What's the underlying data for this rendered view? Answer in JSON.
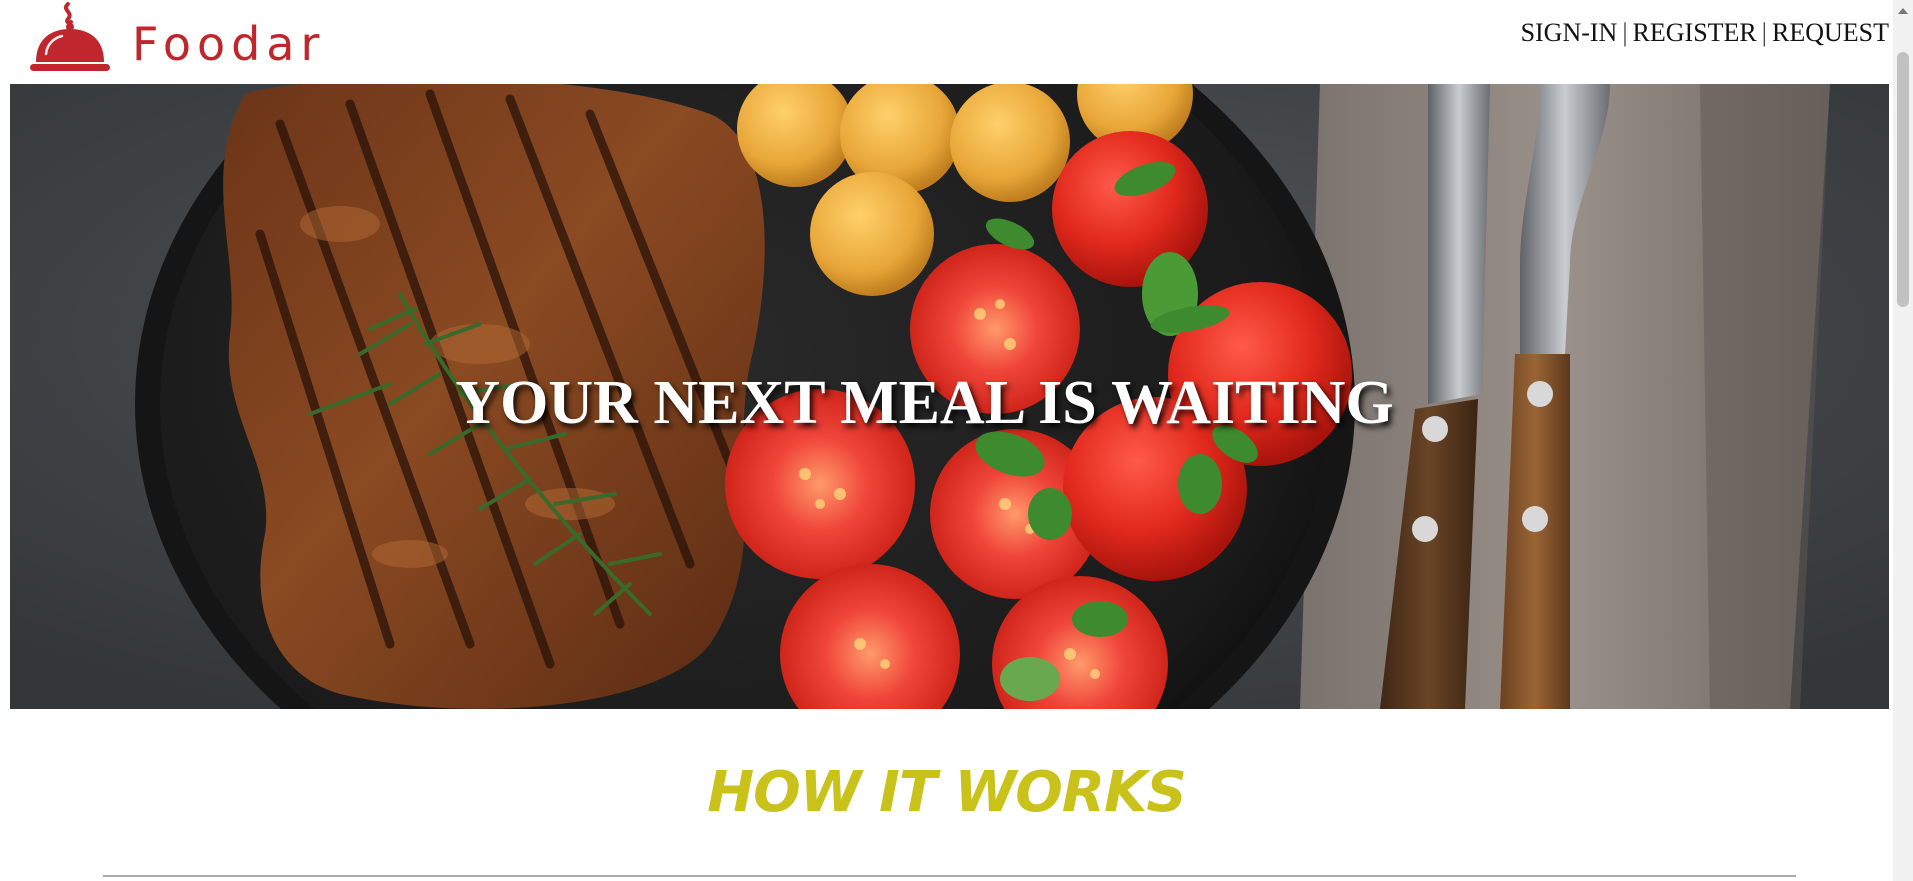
{
  "brand": {
    "name": "Foodar",
    "color": "#c0272d",
    "logo_icon": "cloche-icon"
  },
  "nav": {
    "sign_in": "SIGN-IN",
    "separator": "|",
    "register": "REGISTER",
    "request": "REQUEST"
  },
  "hero": {
    "title": "YOUR NEXT MEAL IS WAITING",
    "image_subject": "grilled-steak-plate-image"
  },
  "how_it_works": {
    "title": "HOW IT WORKS",
    "color": "#c8c21a"
  }
}
